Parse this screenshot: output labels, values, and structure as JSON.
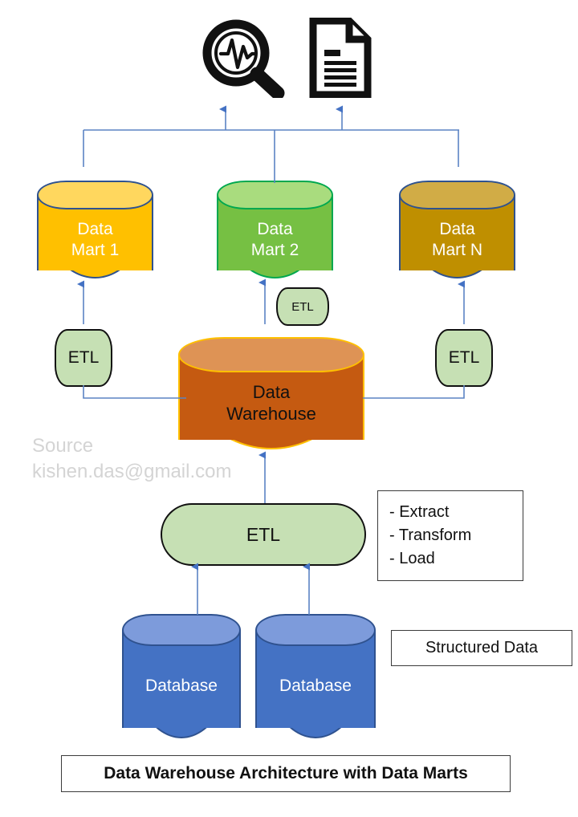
{
  "diagram": {
    "title": "Data Warehouse Architecture with Data Marts",
    "watermark": "Source\nkishen.das@gmail.com",
    "icons": {
      "analytics": "magnifier-analytics-icon",
      "report": "document-report-icon"
    },
    "data_marts": [
      {
        "id": "mart-1",
        "label": "Data\nMart 1",
        "fill": "#FFC000",
        "top_fill": "#FFD75E",
        "stroke": "#2F528F"
      },
      {
        "id": "mart-2",
        "label": "Data\nMart 2",
        "fill": "#76C043",
        "top_fill": "#A9DC7E",
        "stroke": "#00A84F"
      },
      {
        "id": "mart-n",
        "label": "Data\nMart N",
        "fill": "#BF8F00",
        "top_fill": "#D1AC46",
        "stroke": "#2F528F"
      }
    ],
    "warehouse": {
      "id": "data-warehouse",
      "label": "Data\nWarehouse",
      "fill": "#C55A11",
      "top_fill": "#DE9355",
      "stroke": "#FFC000",
      "text_color": "#111111"
    },
    "etl_nodes": [
      {
        "id": "etl-mart-1",
        "label": "ETL"
      },
      {
        "id": "etl-mart-2",
        "label": "ETL"
      },
      {
        "id": "etl-mart-n",
        "label": "ETL"
      },
      {
        "id": "etl-main",
        "label": "ETL"
      }
    ],
    "etl_legend": {
      "id": "etl-legend",
      "text": "- Extract\n- Transform\n- Load"
    },
    "structured_data": {
      "id": "structured-data",
      "label": "Structured Data"
    },
    "databases": [
      {
        "id": "database-1",
        "label": "Database",
        "fill": "#4472C4",
        "top_fill": "#7D9BDB",
        "stroke": "#2F528F"
      },
      {
        "id": "database-2",
        "label": "Database",
        "fill": "#4472C4",
        "top_fill": "#7D9BDB",
        "stroke": "#2F528F"
      }
    ],
    "colors": {
      "connector": "#5B84C4",
      "arrow": "#4472C4",
      "watermark": "#d4d4d4",
      "icon": "#111111"
    }
  }
}
